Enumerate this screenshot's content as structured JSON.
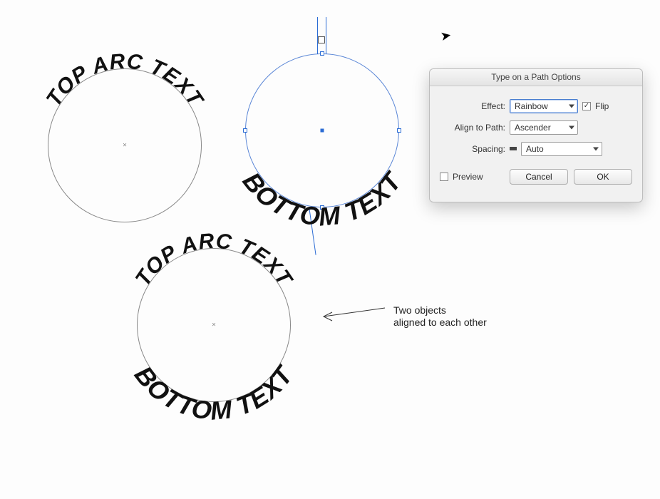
{
  "canvas": {
    "topArc1": "TOP ARC TEXT",
    "bottomArc1": "BOTTOM TEXT",
    "topArc2": "TOP ARC TEXT",
    "bottomArc2": "BOTTOM TEXT"
  },
  "annotation": {
    "line1": "Two objects",
    "line2": "aligned to each other"
  },
  "dialog": {
    "title": "Type on a Path Options",
    "effectLabel": "Effect:",
    "effectValue": "Rainbow",
    "flipLabel": "Flip",
    "flipChecked": true,
    "alignLabel": "Align to Path:",
    "alignValue": "Ascender",
    "spacingLabel": "Spacing:",
    "spacingValue": "Auto",
    "previewLabel": "Preview",
    "previewChecked": false,
    "cancel": "Cancel",
    "ok": "OK"
  }
}
